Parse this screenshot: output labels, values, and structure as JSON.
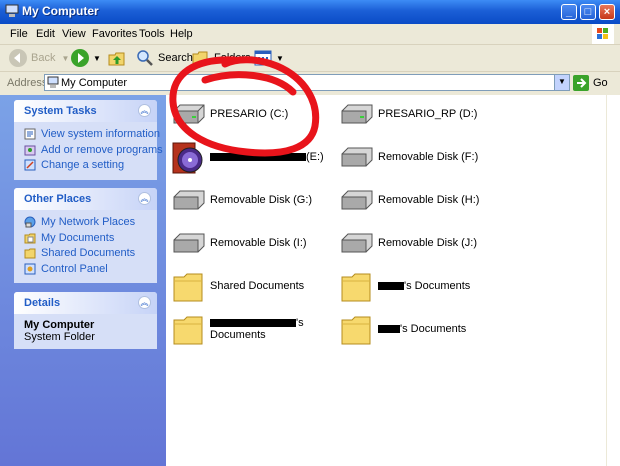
{
  "window": {
    "title": "My Computer"
  },
  "menu": [
    "File",
    "Edit",
    "View",
    "Favorites",
    "Tools",
    "Help"
  ],
  "toolbar": {
    "back": "Back",
    "search": "Search",
    "folders": "Folders"
  },
  "address": {
    "label": "Address",
    "value": "My Computer",
    "go": "Go"
  },
  "system_tasks": {
    "title": "System Tasks",
    "items": [
      "View system information",
      "Add or remove programs",
      "Change a setting"
    ]
  },
  "other_places": {
    "title": "Other Places",
    "items": [
      "My Network Places",
      "My Documents",
      "Shared Documents",
      "Control Panel"
    ]
  },
  "details": {
    "title": "Details",
    "name": "My Computer",
    "type": "System Folder"
  },
  "items": [
    {
      "label": "PRESARIO (C:)",
      "icon": "hard-drive-icon"
    },
    {
      "label": "PRESARIO_RP (D:)",
      "icon": "hard-drive-icon"
    },
    {
      "label": "(E:)",
      "icon": "cd-drive-icon"
    },
    {
      "label": "Removable Disk (F:)",
      "icon": "removable-disk-icon"
    },
    {
      "label": "Removable Disk (G:)",
      "icon": "removable-disk-icon"
    },
    {
      "label": "Removable Disk (H:)",
      "icon": "removable-disk-icon"
    },
    {
      "label": "Removable Disk (I:)",
      "icon": "removable-disk-icon"
    },
    {
      "label": "Removable Disk (J:)",
      "icon": "removable-disk-icon"
    },
    {
      "label": "Shared Documents",
      "icon": "folder-icon"
    },
    {
      "label": "'s Documents",
      "icon": "folder-icon"
    },
    {
      "label": "'s",
      "label2": "Documents",
      "icon": "folder-icon"
    },
    {
      "label": "'s Documents",
      "icon": "folder-icon"
    }
  ],
  "colors": {
    "title_bar": "#0a4bc6",
    "task_pane": "#6375d6",
    "link": "#215dc6",
    "annotation": "#e8141b"
  }
}
